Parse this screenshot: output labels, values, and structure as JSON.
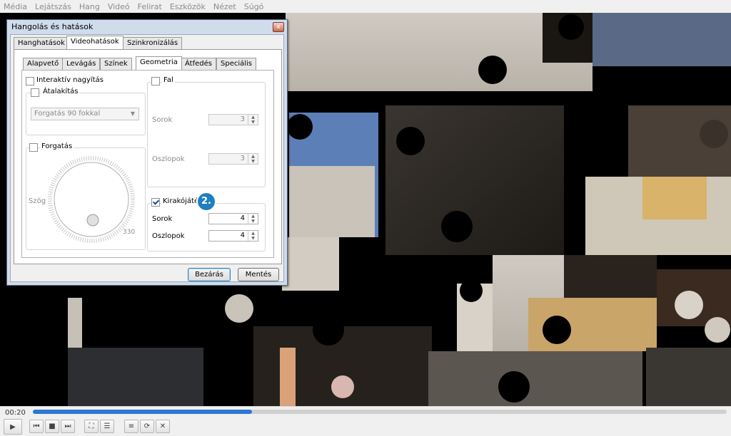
{
  "menu": [
    "Média",
    "Lejátszás",
    "Hang",
    "Videó",
    "Felirat",
    "Eszközök",
    "Nézet",
    "Súgó"
  ],
  "dialog": {
    "title": "Hangolás és hatások",
    "close_symbol": "x",
    "top_tabs": [
      "Hanghatások",
      "Videohatások",
      "Szinkronizálás"
    ],
    "sub_tabs": [
      "Alapvető",
      "Levágás",
      "Színek",
      "Geometria",
      "Átfedés",
      "Speciális"
    ],
    "interactive_zoom_label": "Interaktív nagyítás",
    "transform_label": "Átalakítás",
    "transform_combo": "Forgatás 90 fokkal",
    "rotate_label": "Forgatás",
    "angle_label": "Szög",
    "dial_value": "330",
    "wall_label": "Fal",
    "wall_rows_label": "Sorok",
    "wall_rows_value": "3",
    "wall_cols_label": "Oszlopok",
    "wall_cols_value": "3",
    "puzzle_label": "Kirakójáték",
    "puzzle_rows_label": "Sorok",
    "puzzle_rows_value": "4",
    "puzzle_cols_label": "Oszlopok",
    "puzzle_cols_value": "4",
    "close_button": "Bezárás",
    "save_button": "Mentés",
    "step_badge": "2."
  },
  "player": {
    "time": "00:20",
    "progress_fraction": 0.316
  },
  "colors": {
    "accent": "#2c78d6",
    "badge": "#1f7fc0"
  }
}
